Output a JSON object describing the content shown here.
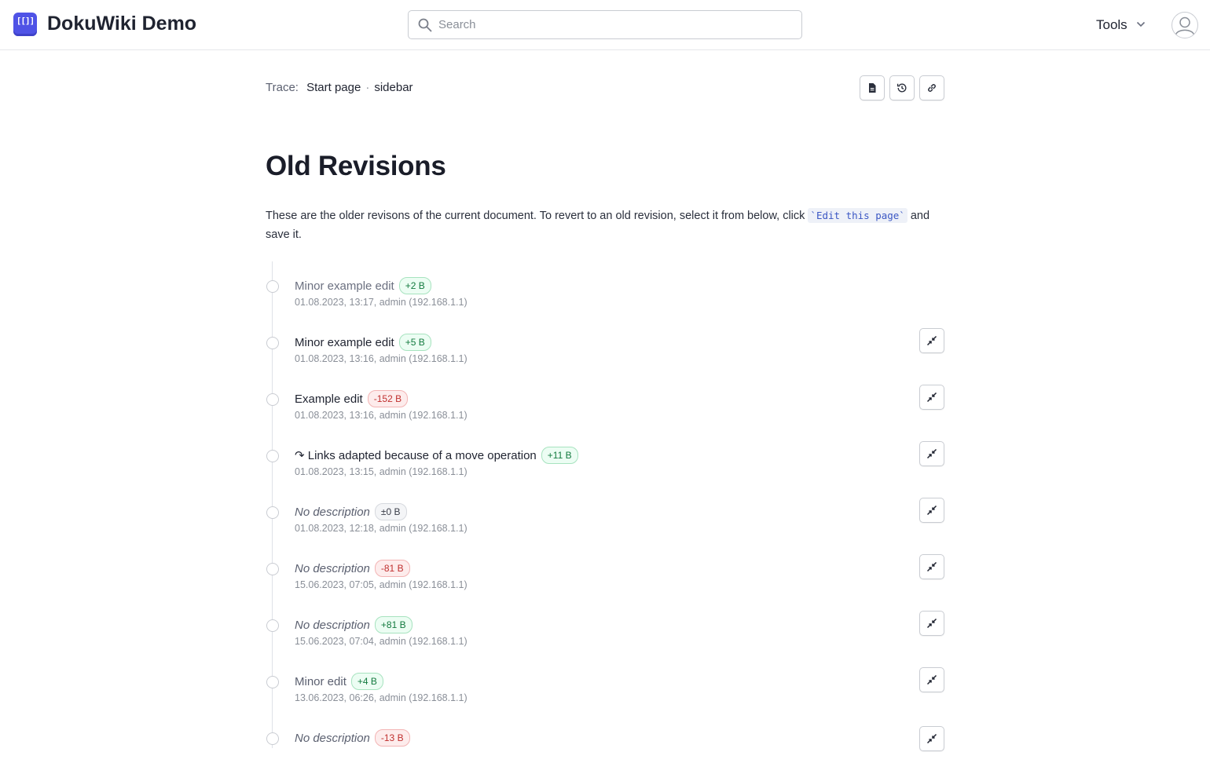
{
  "header": {
    "logo_text": "[[]]",
    "site_title": "DokuWiki Demo",
    "search_placeholder": "Search",
    "tools_label": "Tools"
  },
  "trace": {
    "label": "Trace:",
    "items": [
      "Start page",
      "sidebar"
    ],
    "separator": "·"
  },
  "page_tools": [
    "document-icon",
    "history-icon",
    "link-icon"
  ],
  "page": {
    "title": "Old Revisions",
    "intro_before": "These are the older revisons of the current document. To revert to an old revision, select it from below, click ",
    "intro_code": "`Edit this page`",
    "intro_after": " and save it."
  },
  "revisions": [
    {
      "summary": "Minor example edit",
      "size": "+2 B",
      "change": "pos",
      "meta": "01.08.2023, 13:17, admin (192.168.1.1)",
      "current": true
    },
    {
      "summary": "Minor example edit",
      "size": "+5 B",
      "change": "pos",
      "meta": "01.08.2023, 13:16, admin (192.168.1.1)"
    },
    {
      "summary": "Example edit",
      "size": "-152 B",
      "change": "neg",
      "meta": "01.08.2023, 13:16, admin (192.168.1.1)"
    },
    {
      "summary": "↷ Links adapted because of a move operation",
      "size": "+11 B",
      "change": "pos",
      "meta": "01.08.2023, 13:15, admin (192.168.1.1)",
      "move": true
    },
    {
      "summary": "No description",
      "size": "±0 B",
      "change": "zero",
      "meta": "01.08.2023, 12:18, admin (192.168.1.1)",
      "nodesc": true
    },
    {
      "summary": "No description",
      "size": "-81 B",
      "change": "neg",
      "meta": "15.06.2023, 07:05, admin (192.168.1.1)",
      "nodesc": true
    },
    {
      "summary": "No description",
      "size": "+81 B",
      "change": "pos",
      "meta": "15.06.2023, 07:04, admin (192.168.1.1)",
      "nodesc": true
    },
    {
      "summary": "Minor edit",
      "size": "+4 B",
      "change": "pos",
      "meta": "13.06.2023, 06:26, admin (192.168.1.1)",
      "minor": true
    },
    {
      "summary": "No description",
      "size": "-13 B",
      "change": "neg",
      "meta": "",
      "nodesc": true
    }
  ]
}
